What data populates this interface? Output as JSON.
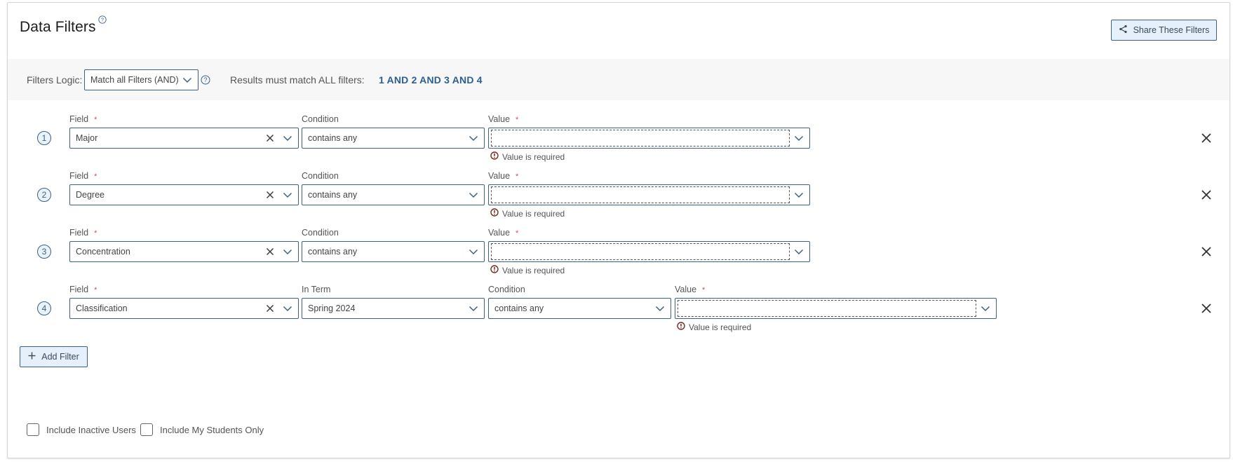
{
  "header": {
    "title": "Data Filters",
    "title_help_icon": "question-circle-icon",
    "share_button": {
      "label": "Share These Filters",
      "icon": "share-icon"
    }
  },
  "logic": {
    "label": "Filters Logic:",
    "selected": "Match all Filters (AND)",
    "help_icon": "question-circle-icon",
    "results_label": "Results must match ALL filters:",
    "results_expression": "1 AND 2 AND 3 AND 4"
  },
  "filters": [
    {
      "number": "1",
      "field_label": "Field",
      "field_required": "*",
      "field_value": "Major",
      "condition_label": "Condition",
      "condition_value": "contains any",
      "value_label": "Value",
      "value_required": "*",
      "value_value": "",
      "error": "Value is required"
    },
    {
      "number": "2",
      "field_label": "Field",
      "field_required": "*",
      "field_value": "Degree",
      "condition_label": "Condition",
      "condition_value": "contains any",
      "value_label": "Value",
      "value_required": "*",
      "value_value": "",
      "error": "Value is required"
    },
    {
      "number": "3",
      "field_label": "Field",
      "field_required": "*",
      "field_value": "Concentration",
      "condition_label": "Condition",
      "condition_value": "contains any",
      "value_label": "Value",
      "value_required": "*",
      "value_value": "",
      "error": "Value is required"
    },
    {
      "number": "4",
      "field_label": "Field",
      "field_required": "*",
      "field_value": "Classification",
      "term_label": "In Term",
      "term_value": "Spring 2024",
      "condition_label": "Condition",
      "condition_value": "contains any",
      "value_label": "Value",
      "value_required": "*",
      "value_value": "",
      "error": "Value is required"
    }
  ],
  "add_filter": {
    "label": "Add Filter",
    "icon": "plus-icon"
  },
  "options": {
    "include_inactive": {
      "label": "Include Inactive Users",
      "checked": false
    },
    "my_students_only": {
      "label": "Include My Students Only",
      "checked": false
    }
  },
  "colors": {
    "accent": "#3c6182",
    "button_bg": "#e6f0fa",
    "expression_blue": "#2d5f8e",
    "required_star": "#c45656",
    "error_icon": "#7a2a1e",
    "band_bg": "#f7f7f7"
  }
}
